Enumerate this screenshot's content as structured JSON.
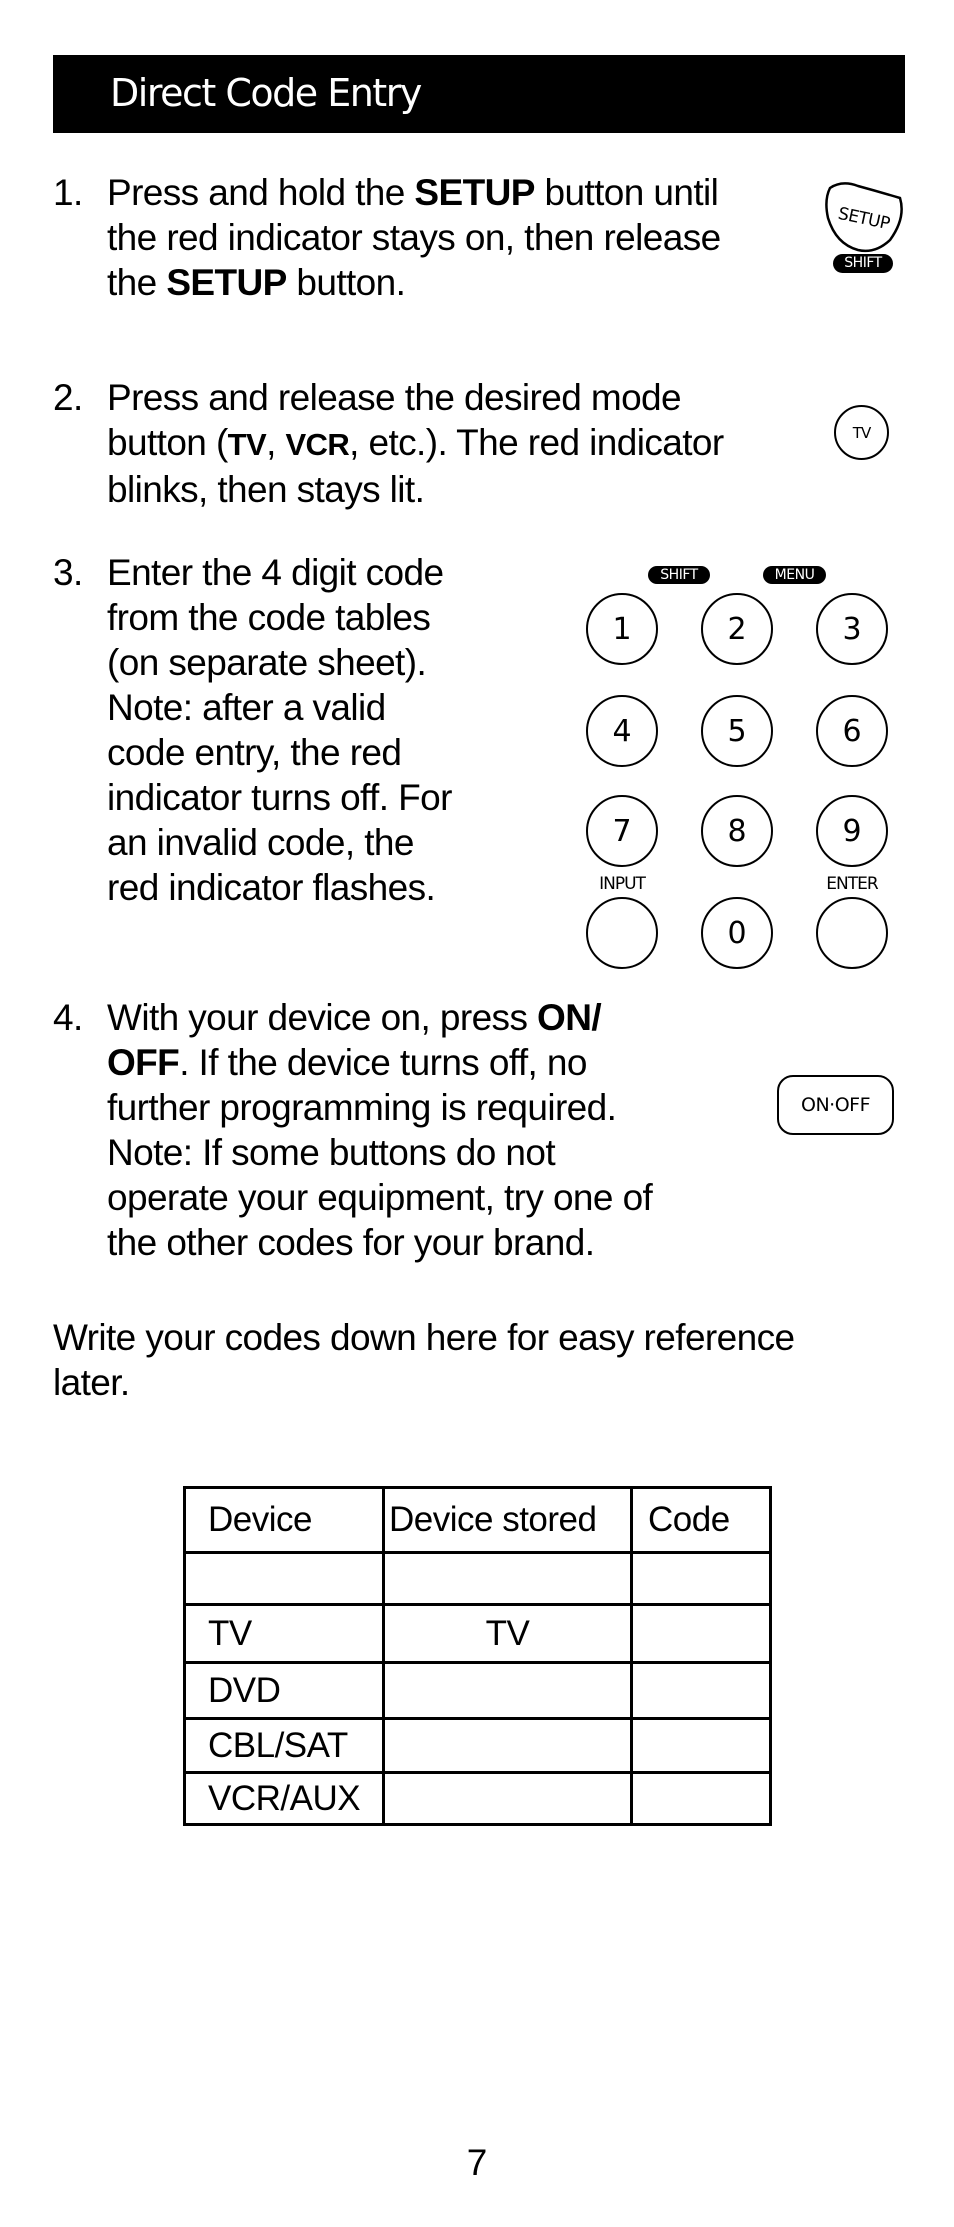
{
  "header": {
    "title": "Direct Code Entry"
  },
  "steps": [
    {
      "number": "1.",
      "lines": [
        [
          "Press and hold the ",
          {
            "b": "SETUP"
          },
          " button until"
        ],
        [
          "the red indicator stays on, then release"
        ],
        [
          "the ",
          {
            "b": "SETUP"
          },
          " button."
        ]
      ],
      "icon": {
        "name": "setup-button-icon",
        "label": "SETUP",
        "sub_label": "SHIFT"
      }
    },
    {
      "number": "2.",
      "lines": [
        [
          "Press and release the desired mode"
        ],
        [
          "button (",
          {
            "sb": "TV"
          },
          ", ",
          {
            "sb": "VCR"
          },
          ", etc.). The red indicator"
        ],
        [
          "blinks, then stays lit."
        ]
      ],
      "icon": {
        "name": "tv-button-icon",
        "label": "TV"
      }
    },
    {
      "number": "3.",
      "lines": [
        [
          "Enter the 4 digit code"
        ],
        [
          "from the code tables"
        ],
        [
          "(on separate sheet)."
        ],
        [
          "Note: after a valid"
        ],
        [
          "code entry, the red"
        ],
        [
          "indicator turns off.  For"
        ],
        [
          "an invalid code, the"
        ],
        [
          "red indicator flashes."
        ]
      ]
    },
    {
      "number": "4.",
      "lines": [
        [
          "With your device on, press ",
          {
            "b": "ON/"
          }
        ],
        [
          {
            "b": "OFF"
          },
          ". If the device turns off, no"
        ],
        [
          "further programming is required."
        ],
        [
          "Note: If some buttons do not"
        ],
        [
          "operate your equipment, try one of"
        ],
        [
          "the other codes for your brand."
        ]
      ],
      "icon": {
        "name": "on-off-button-icon",
        "label": "ON·OFF"
      }
    }
  ],
  "keypad": {
    "top_labels": [
      "SHIFT",
      "MENU"
    ],
    "keys": [
      "1",
      "2",
      "3",
      "4",
      "5",
      "6",
      "7",
      "8",
      "9",
      "",
      "0",
      ""
    ],
    "bottom_labels": {
      "left": "INPUT",
      "right": "ENTER"
    }
  },
  "note": {
    "line1": "Write your codes down here for easy reference",
    "line2": "later."
  },
  "codes_table": {
    "headers": [
      "Device",
      "Device stored",
      "Code"
    ],
    "rows": [
      [
        "",
        "",
        ""
      ],
      [
        "TV",
        "TV",
        ""
      ],
      [
        "DVD",
        "",
        ""
      ],
      [
        "CBL/SAT",
        "",
        ""
      ],
      [
        "VCR/AUX",
        "",
        ""
      ]
    ]
  },
  "page_number": "7"
}
